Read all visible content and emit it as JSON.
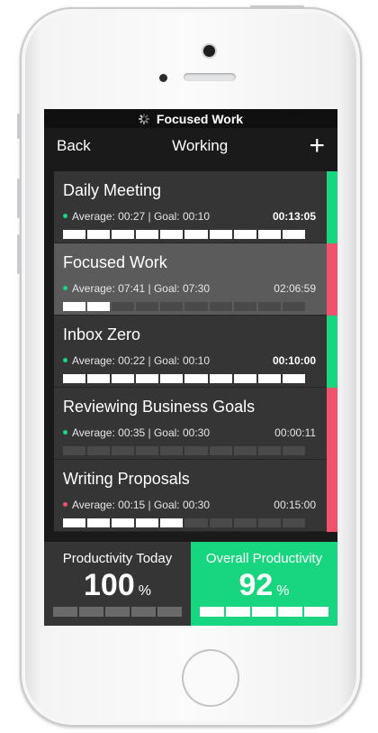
{
  "status_bar": {
    "title": "Focused Work"
  },
  "nav": {
    "back_label": "Back",
    "title": "Working",
    "add_label": "+"
  },
  "colors": {
    "green": "#18d680",
    "red": "#f0516b",
    "bar_on": "#ffffff",
    "bar_off": "#4a4a4a"
  },
  "tasks": [
    {
      "name": "Daily Meeting",
      "average": "Average: 00:27 | Goal: 00:10",
      "time": "00:13:05",
      "time_bold": true,
      "dot": "green",
      "indicator": "green",
      "segments_on": 10,
      "segments_total": 10,
      "active": false
    },
    {
      "name": "Focused Work",
      "average": "Average: 07:41 | Goal: 07:30",
      "time": "02:06:59",
      "time_bold": false,
      "dot": "green",
      "indicator": "red",
      "segments_on": 2,
      "segments_total": 10,
      "active": true
    },
    {
      "name": "Inbox Zero",
      "average": "Average: 00:22 | Goal: 00:10",
      "time": "00:10:00",
      "time_bold": true,
      "dot": "green",
      "indicator": "green",
      "segments_on": 10,
      "segments_total": 10,
      "active": false
    },
    {
      "name": "Reviewing Business Goals",
      "average": "Average: 00:35 | Goal: 00:30",
      "time": "00:00:11",
      "time_bold": false,
      "dot": "green",
      "indicator": "red",
      "segments_on": 0,
      "segments_total": 10,
      "active": false
    },
    {
      "name": "Writing Proposals",
      "average": "Average: 00:15 | Goal: 00:30",
      "time": "00:15:00",
      "time_bold": false,
      "dot": "red",
      "indicator": "red",
      "segments_on": 5,
      "segments_total": 10,
      "active": false
    }
  ],
  "footer": {
    "today": {
      "label": "Productivity Today",
      "value": "100",
      "unit": "%",
      "bars": 5
    },
    "overall": {
      "label": "Overall Productivity",
      "value": "92",
      "unit": "%",
      "bars": 5
    }
  }
}
